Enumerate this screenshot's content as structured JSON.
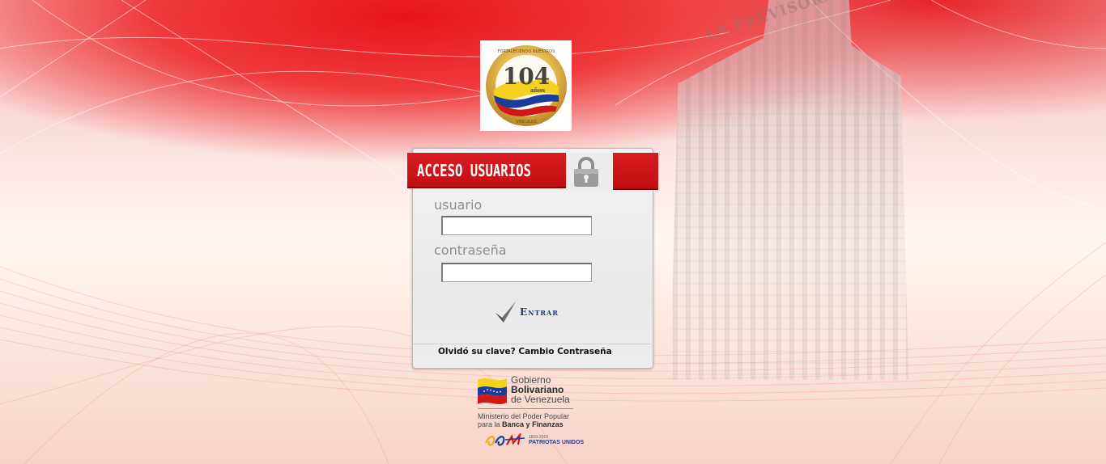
{
  "header": {
    "title": "ACCESO USUARIOS",
    "lock_icon": "padlock-icon"
  },
  "logo": {
    "alt": "104 años logo",
    "number": "104",
    "years_word": "años",
    "ring_top": "FORTALECIENDO NUESTROS",
    "ring_bottom": "VINCULOS"
  },
  "background": {
    "building_sign": "LA PREVISORA"
  },
  "form": {
    "username_label": "usuario",
    "username_value": "",
    "password_label": "contraseña",
    "password_value": "",
    "submit_label": "Entrar"
  },
  "links": {
    "forgot_text": "Olvidó su clave?",
    "change_password_text": "Cambio Contraseña"
  },
  "footer": {
    "gov_line1": "Gobierno",
    "gov_line2": "Bolivariano",
    "gov_line3": "de Venezuela",
    "ministry_line1": "Ministerio del Poder Popular",
    "ministry_line2_prefix": "para la",
    "ministry_line2_bold": "Banca y Finanzas",
    "bicentennial_years": "1810-2010",
    "bicentennial_label": "PATRIOTAS UNIDOS"
  },
  "colors": {
    "brand_red": "#c10e12",
    "enter_blue": "#1f3b73"
  }
}
